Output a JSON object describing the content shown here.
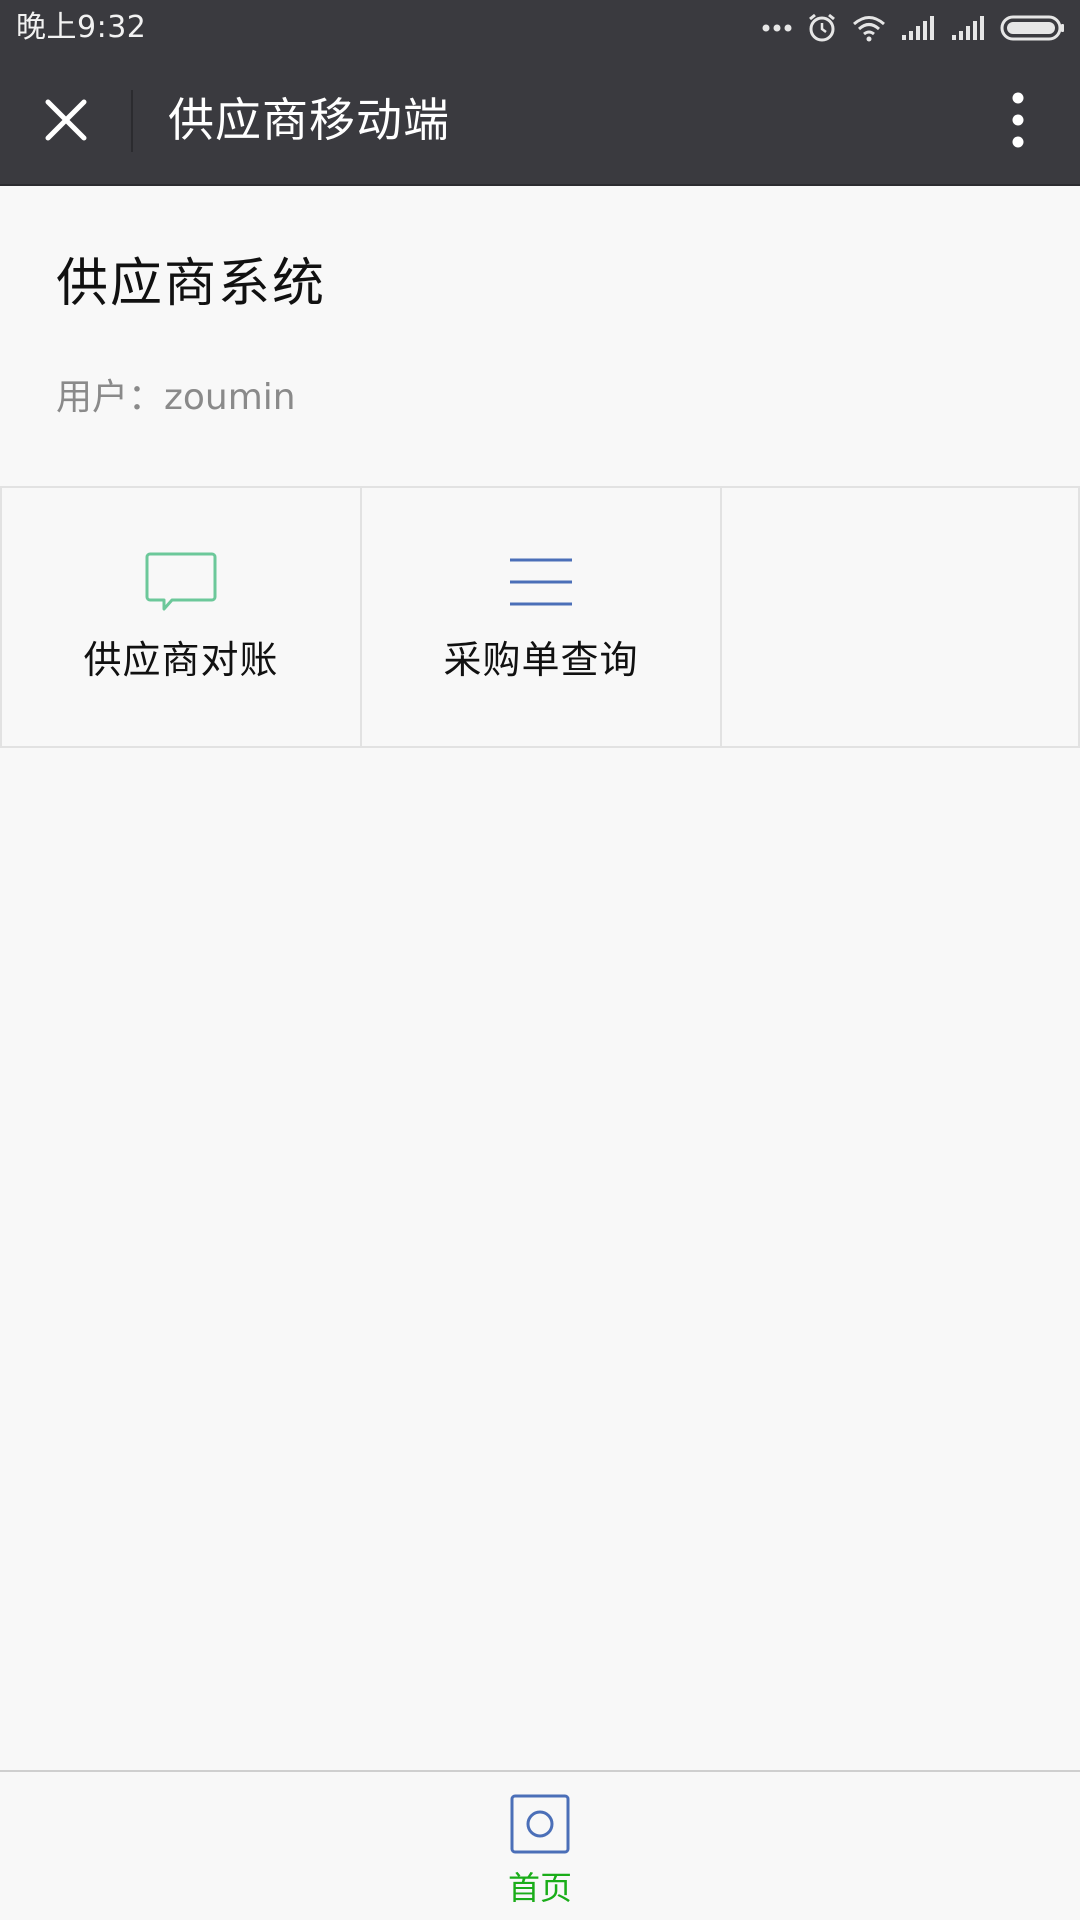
{
  "status_bar": {
    "time": "晚上9:32",
    "icons": [
      "more-dots-icon",
      "alarm-icon",
      "wifi-icon",
      "signal-icon",
      "signal-icon",
      "battery-icon"
    ]
  },
  "title_bar": {
    "title": "供应商移动端",
    "close_icon": "close-icon",
    "more_icon": "more-vertical-icon"
  },
  "header": {
    "title": "供应商系统",
    "user_label": "用户：zoumin"
  },
  "grid": {
    "items": [
      {
        "label": "供应商对账",
        "icon": "chat-bubble-icon",
        "icon_color": "#6cc89a"
      },
      {
        "label": "采购单查询",
        "icon": "list-lines-icon",
        "icon_color": "#4b6fb8"
      },
      {
        "label": "",
        "icon": "",
        "icon_color": ""
      }
    ]
  },
  "tab_bar": {
    "items": [
      {
        "label": "首页",
        "icon": "home-square-icon",
        "active": true,
        "active_color": "#1aad19",
        "icon_color": "#4b6fb8"
      }
    ]
  },
  "colors": {
    "header_bg": "#3a3a3f",
    "page_bg": "#f8f8f8",
    "accent_green": "#1aad19"
  }
}
